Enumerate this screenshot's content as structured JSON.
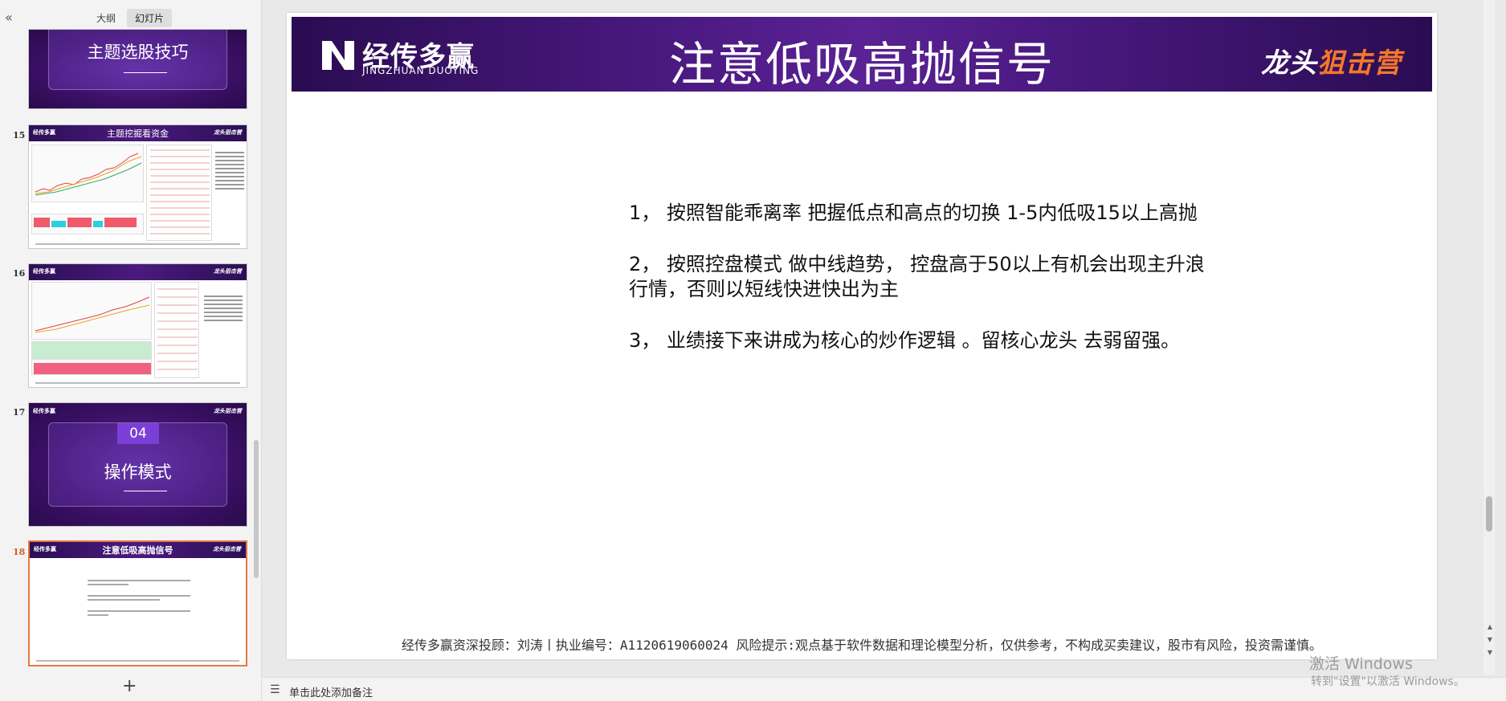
{
  "panel": {
    "collapse_icon": "«",
    "tabs": [
      {
        "label": "大纲"
      },
      {
        "label": "幻灯片"
      }
    ],
    "add_slide": "+"
  },
  "thumbnails": [
    {
      "number": "",
      "title": "主题选股技巧",
      "kind": "section"
    },
    {
      "number": "15",
      "title": "主题挖掘看资金",
      "kind": "chart"
    },
    {
      "number": "16",
      "title": "",
      "kind": "chart"
    },
    {
      "number": "17",
      "badge": "04",
      "title": "操作模式",
      "kind": "section"
    },
    {
      "number": "18",
      "title": "注意低吸高抛信号",
      "kind": "text",
      "active": true
    }
  ],
  "slide": {
    "logo_cn": "经传多赢",
    "logo_en": "JINGZHUAN DUOYING",
    "title": "注意低吸高抛信号",
    "brand_left": "龙头",
    "brand_right": "狙击营",
    "points": [
      "1，    按照智能乖离率  把握低点和高点的切换    1-5内低吸15以上高抛",
      "2，    按照控盘模式 做中线趋势，   控盘高于50以上有机会出现主升浪行情，否则以短线快进快出为主",
      "3，    业绩接下来讲成为核心的炒作逻辑 。留核心龙头 去弱留强。"
    ],
    "footer": "经传多赢资深投顾：刘涛丨执业编号：A1120619060024  风险提示:观点基于软件数据和理论模型分析，仅供参考，不构成买卖建议，股市有风险，投资需谨慎。"
  },
  "notes": {
    "icon": "☰",
    "placeholder": "单击此处添加备注"
  },
  "watermark": {
    "line1": "激活 Windows",
    "line2": "转到\"设置\"以激活 Windows。"
  },
  "colors": {
    "header_purple": "#4c1a83",
    "accent_orange": "#f5772a",
    "active_border": "#e8773f"
  }
}
